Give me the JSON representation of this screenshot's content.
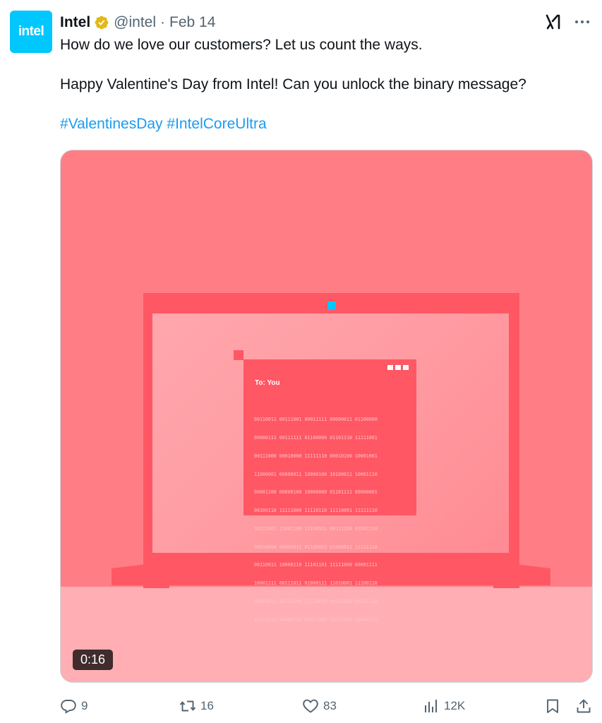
{
  "account": {
    "avatar_text": "intel",
    "name": "Intel",
    "handle": "@intel",
    "separator": "·",
    "date": "Feb 14"
  },
  "tweet": {
    "line1": "How do we love our customers? Let us count the ways.",
    "line2": "Happy Valentine's Day from Intel! Can you unlock the binary message?",
    "hashtag1": "#ValentinesDay",
    "hashtag2": "#IntelCoreUltra"
  },
  "media": {
    "window_label": "To: You",
    "binary_rows": [
      "00110011 00111001 00011111 00000011 01100000",
      "00000111 00111111 01100000 01101110 11111001",
      "00111000 00010000 11111110 00010100 10001001",
      "11000001 00000011 10000100 10100011 10001110",
      "00001100 00000100 10000000 01101111 00000001",
      "00100110 11111000 11110110 11110001 11111110",
      "10111001 11001100 11100011 00111100 01001110",
      "00010000 00000011 01100001 01000011 11111110",
      "00110011 10000110 11101101 11111000 00001111",
      "10001111 00111011 01000111 11010001 11100110",
      "00000011 00111000 11110010 00011000 00011110",
      "11111111 00000110 00011000 10011001 10000111"
    ],
    "duration": "0:16",
    "colors": {
      "background": "#ff7e86",
      "laptop": "#ff5764",
      "screen": "#ffa7ad",
      "floor": "#ffaeb4",
      "camera": "#00c7fd"
    }
  },
  "actions": {
    "replies": "9",
    "reposts": "16",
    "likes": "83",
    "views": "12K"
  },
  "colors": {
    "brand": "#00c7fd",
    "link": "#1d9bf0",
    "secondary_text": "#536471",
    "verified_badge": "#e2b719"
  }
}
